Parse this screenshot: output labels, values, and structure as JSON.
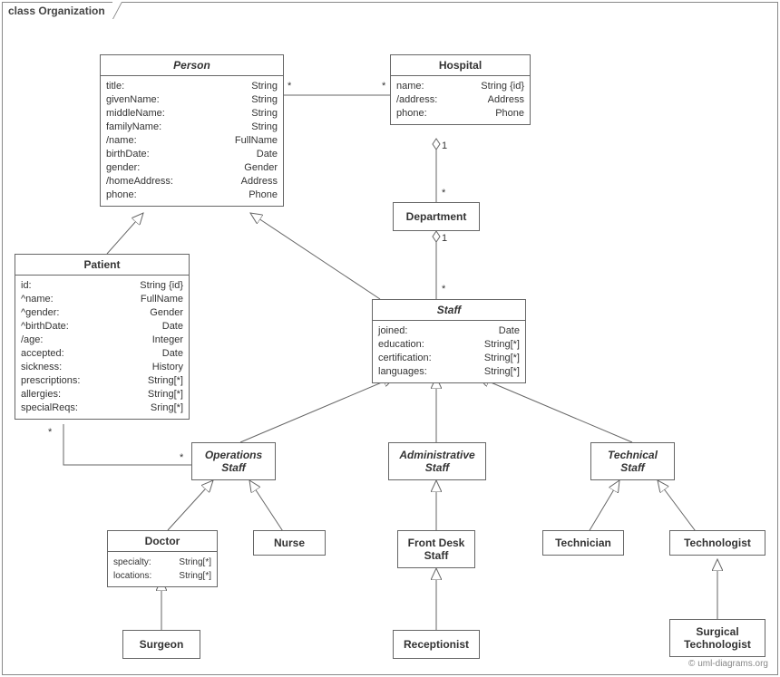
{
  "frame": {
    "title": "class Organization"
  },
  "classes": {
    "person": {
      "name": "Person",
      "attrs": [
        {
          "n": "title:",
          "t": "String"
        },
        {
          "n": "givenName:",
          "t": "String"
        },
        {
          "n": "middleName:",
          "t": "String"
        },
        {
          "n": "familyName:",
          "t": "String"
        },
        {
          "n": "/name:",
          "t": "FullName"
        },
        {
          "n": "birthDate:",
          "t": "Date"
        },
        {
          "n": "gender:",
          "t": "Gender"
        },
        {
          "n": "/homeAddress:",
          "t": "Address"
        },
        {
          "n": "phone:",
          "t": "Phone"
        }
      ]
    },
    "hospital": {
      "name": "Hospital",
      "attrs": [
        {
          "n": "name:",
          "t": "String {id}"
        },
        {
          "n": "/address:",
          "t": "Address"
        },
        {
          "n": "phone:",
          "t": "Phone"
        }
      ]
    },
    "patient": {
      "name": "Patient",
      "attrs": [
        {
          "n": "id:",
          "t": "String {id}"
        },
        {
          "n": "^name:",
          "t": "FullName"
        },
        {
          "n": "^gender:",
          "t": "Gender"
        },
        {
          "n": "^birthDate:",
          "t": "Date"
        },
        {
          "n": "/age:",
          "t": "Integer"
        },
        {
          "n": "accepted:",
          "t": "Date"
        },
        {
          "n": "sickness:",
          "t": "History"
        },
        {
          "n": "prescriptions:",
          "t": "String[*]"
        },
        {
          "n": "allergies:",
          "t": "String[*]"
        },
        {
          "n": "specialReqs:",
          "t": "Sring[*]"
        }
      ]
    },
    "staff": {
      "name": "Staff",
      "attrs": [
        {
          "n": "joined:",
          "t": "Date"
        },
        {
          "n": "education:",
          "t": "String[*]"
        },
        {
          "n": "certification:",
          "t": "String[*]"
        },
        {
          "n": "languages:",
          "t": "String[*]"
        }
      ]
    },
    "department": {
      "name": "Department"
    },
    "opsStaff": {
      "name": "Operations\nStaff"
    },
    "adminStaff": {
      "name": "Administrative\nStaff"
    },
    "techStaff": {
      "name": "Technical\nStaff"
    },
    "doctor": {
      "name": "Doctor",
      "attrs": [
        {
          "n": "specialty:",
          "t": "String[*]"
        },
        {
          "n": "locations:",
          "t": "String[*]"
        }
      ]
    },
    "nurse": {
      "name": "Nurse"
    },
    "frontDesk": {
      "name": "Front Desk\nStaff"
    },
    "technician": {
      "name": "Technician"
    },
    "technologist": {
      "name": "Technologist"
    },
    "surgeon": {
      "name": "Surgeon"
    },
    "receptionist": {
      "name": "Receptionist"
    },
    "surgTech": {
      "name": "Surgical\nTechnologist"
    }
  },
  "mults": {
    "ph_star_left": "*",
    "ph_star_right": "*",
    "hd_1": "1",
    "hd_star": "*",
    "ds_1": "1",
    "ds_star": "*",
    "po_star_patient": "*",
    "po_star_ops": "*"
  },
  "watermark": "© uml-diagrams.org"
}
